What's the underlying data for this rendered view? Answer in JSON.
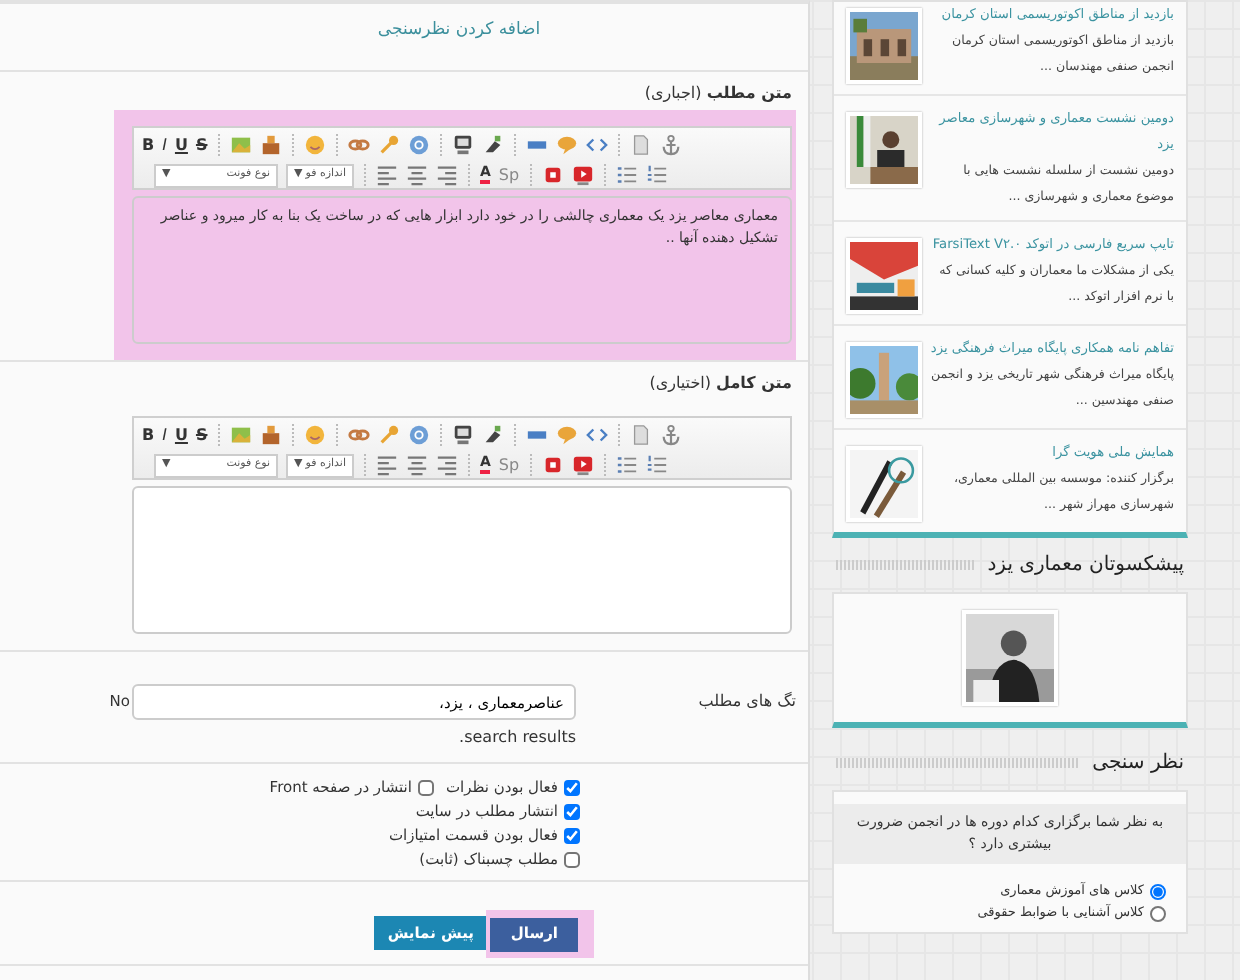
{
  "main": {
    "add_poll_link": "اضافه کردن نظرسنجی",
    "editors": [
      {
        "label": "**متن مطلب** (اجباری)",
        "highlighted": true,
        "value": "معماری معاصر یزد یک معماری چالشی را در خود دارد ابزار هایی که در ساخت یک بنا به کار میرود و عناصر تشکیل دهنده آنها ..",
        "toolbar": {
          "bold": "B",
          "italic": "I",
          "underline": "U",
          "strike": "S",
          "font": "نوع فونت",
          "size": "اندازه فو",
          "caret": "▼",
          "text_color": "A",
          "spell": "Sp"
        }
      },
      {
        "label": "**متن کامل** (اختیاری)",
        "highlighted": false,
        "toolbar": {
          "bold": "B",
          "italic": "I",
          "underline": "U",
          "strike": "S",
          "font": "نوع فونت",
          "size": "اندازه فو",
          "caret": "▼",
          "text_color": "A",
          "spell": "Sp"
        }
      }
    ],
    "tags": {
      "label": "تگ های مطلب",
      "value": "عناصرمعماری ، یزد،",
      "side_note": "No",
      "hint": "search results."
    },
    "option_rows": [
      [
        {
          "label": "فعال بودن نظرات",
          "checked": true
        },
        {
          "label": "انتشار در صفحه Front",
          "checked": false
        }
      ],
      [
        {
          "label": "انتشار مطلب در سایت",
          "checked": true
        }
      ],
      [
        {
          "label": "فعال بودن قسمت امتیازات",
          "checked": true
        }
      ],
      [
        {
          "label": "مطلب چسبناک (ثابت)",
          "checked": false
        }
      ]
    ],
    "buttons": [
      {
        "label": "ارسال",
        "kind": "primary",
        "highlighted": true
      },
      {
        "label": "پیش نمایش",
        "kind": "info",
        "highlighted": false
      }
    ]
  },
  "sidebar": {
    "news": [
      {
        "title": "بازدید از مناطق اکوتوریسمی استان کرمان",
        "summary": "بازدید از مناطق اکوتوریسمی استان کرمان انجمن صنفی مهندسان ..."
      },
      {
        "title": "دومین نشست معماری و شهرسازی معاصر یزد",
        "summary": "دومین نشست از سلسله نشست هایی با موضوع معماری و شهرسازی ..."
      },
      {
        "title": "تایپ سریع فارسی در اتوکد FarsiText V۲.۰",
        "summary": "یکی از مشکلات ما معماران و کلیه کسانی که با نرم افزار اتوکد ..."
      },
      {
        "title": "تفاهم نامه همکاری پایگاه میراث فرهنگی یزد",
        "summary": "پایگاه میراث فرهنگی شهر تاریخی یزد و انجمن صنفی مهندسین ..."
      },
      {
        "title": "همایش ملی هویت گرا",
        "summary": "برگزار کننده: موسسه بین المللی معماری، شهرسازی مهراز شهر ..."
      }
    ],
    "leaders": {
      "title": "پیشکسوتان معماری یزد"
    },
    "poll": {
      "title": "نظر سنجی",
      "question": "به نظر شما برگزاری کدام دوره ها در انجمن ضرورت بیشتری دارد ؟",
      "options": [
        {
          "label": "کلاس های آموزش معماری",
          "selected": true
        },
        {
          "label": "کلاس آشنایی با ضوابط حقوقی",
          "selected": false
        }
      ]
    }
  }
}
